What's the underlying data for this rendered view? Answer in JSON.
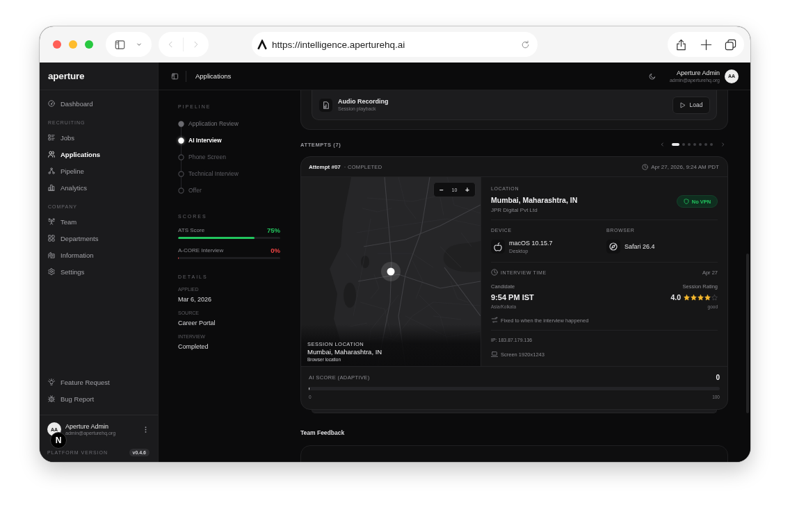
{
  "browser": {
    "url": "https://intelligence.aperturehq.ai"
  },
  "sidebar": {
    "logo": "aperture",
    "items": [
      {
        "kind": "link",
        "label": "Dashboard",
        "selected": false
      },
      {
        "kind": "heading",
        "label": "RECRUITING"
      },
      {
        "kind": "link",
        "label": "Jobs",
        "selected": false
      },
      {
        "kind": "link",
        "label": "Applications",
        "selected": true
      },
      {
        "kind": "link",
        "label": "Pipeline",
        "selected": false
      },
      {
        "kind": "link",
        "label": "Analytics",
        "selected": false
      },
      {
        "kind": "heading",
        "label": "COMPANY"
      },
      {
        "kind": "link",
        "label": "Team",
        "selected": false
      },
      {
        "kind": "link",
        "label": "Departments",
        "selected": false
      },
      {
        "kind": "link",
        "label": "Information",
        "selected": false
      },
      {
        "kind": "link",
        "label": "Settings",
        "selected": false
      }
    ],
    "footer_links": [
      {
        "label": "Feature Request"
      },
      {
        "label": "Bug Report"
      }
    ],
    "user": {
      "initials": "AA",
      "name": "Aperture Admin",
      "email": "admin@aperturehq.org"
    },
    "version_label": "PLATFORM VERSION",
    "version": "v0.4.6"
  },
  "dev_indicator": {
    "label": "N"
  },
  "topbar": {
    "title": "Applications",
    "user": {
      "name": "Aperture Admin",
      "email": "admin@aperturehq.org",
      "initials": "AA"
    }
  },
  "pipeline": {
    "heading": "PIPELINE",
    "steps": [
      {
        "label": "Application Review",
        "completed": true,
        "selected": false
      },
      {
        "label": "AI Interview",
        "completed": false,
        "selected": true
      },
      {
        "label": "Phone Screen",
        "completed": false,
        "selected": false
      },
      {
        "label": "Technical Interview",
        "completed": false,
        "selected": false
      },
      {
        "label": "Offer",
        "completed": false,
        "selected": false
      }
    ]
  },
  "scores": {
    "heading": "SCORES",
    "items": [
      {
        "label": "ATS Score",
        "value": "75%",
        "level": 0.75,
        "color": "#22c55e"
      },
      {
        "label": "A-CORE Interview",
        "value": "0%",
        "level": 0,
        "color": "#ef4444"
      }
    ]
  },
  "details": {
    "heading": "DETAILS",
    "fields": [
      {
        "label": "APPLIED",
        "value": "Mar 6, 2026"
      },
      {
        "label": "SOURCE",
        "value": "Career Portal"
      },
      {
        "label": "INTERVIEW",
        "value": "Completed"
      }
    ]
  },
  "recording": {
    "title": "Audio Recording",
    "subtitle": "Session playback",
    "button": "Load"
  },
  "attempts": {
    "heading": "ATTEMPTS (7)",
    "pages": [
      {
        "selected": true
      },
      {
        "selected": false
      },
      {
        "selected": false
      },
      {
        "selected": false
      },
      {
        "selected": false
      },
      {
        "selected": false
      },
      {
        "selected": false
      }
    ]
  },
  "attempt": {
    "title": "Attempt #07",
    "status": "· COMPLETED",
    "timestamp": "Apr 27, 2026, 9:24 AM PDT",
    "map": {
      "zoom_out": "−",
      "zoom": "10",
      "zoom_in": "+",
      "caption_label": "SESSION LOCATION",
      "caption_place": "Mumbai, Maharashtra, IN",
      "caption_note": "Browser location"
    },
    "location": {
      "label": "LOCATION",
      "place": "Mumbai, Maharashtra, IN",
      "provider": "JPR Digital Pvt Ltd",
      "vpn_badge": "No VPN"
    },
    "device": {
      "label": "DEVICE",
      "name": "macOS 10.15.7",
      "type": "Desktop"
    },
    "browser": {
      "label": "BROWSER",
      "name": "Safari 26.4"
    },
    "interview_time": {
      "label": "INTERVIEW TIME",
      "date": "Apr 27",
      "candidate_label": "Candidate",
      "time": "9:54 PM IST",
      "timezone": "Asia/Kolkata",
      "rating_label": "Session Rating",
      "rating": "4.0",
      "stars": 4,
      "rating_word": "good",
      "note": "Fixed to when the interview happened"
    },
    "ip": "IP: 183.87.179.136",
    "screen": "Screen 1920x1243",
    "ai_score": {
      "label": "AI SCORE (ADAPTIVE)",
      "value": "0",
      "level": 0,
      "min": "0",
      "max": "100"
    }
  },
  "team_feedback": {
    "heading": "Team Feedback"
  }
}
